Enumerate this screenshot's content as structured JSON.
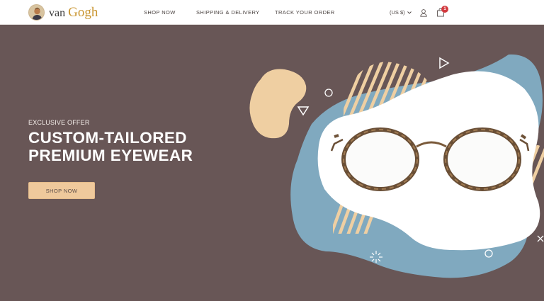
{
  "header": {
    "logo": {
      "prefix": "van",
      "brand": "Gogh"
    },
    "nav": [
      {
        "label": "SHOP NOW"
      },
      {
        "label": "SHIPPING & DELIVERY"
      },
      {
        "label": "TRACK YOUR ORDER"
      }
    ],
    "currency": {
      "label": "(US $)"
    },
    "icons": {
      "currency_toggle": "chevron-down-icon",
      "account": "user-icon",
      "cart": "shopping-bag-icon"
    },
    "cart_count": "1"
  },
  "hero": {
    "eyebrow": "EXCLUSIVE OFFER",
    "headline_line1": "CUSTOM-TAILORED",
    "headline_line2": "PREMIUM EYEWEAR",
    "cta_label": "SHOP NOW"
  },
  "colors": {
    "hero_background": "#685656",
    "accent_sand": "#efc99c",
    "blob_blue": "#7fa8be",
    "badge_red": "#d23a3f"
  }
}
